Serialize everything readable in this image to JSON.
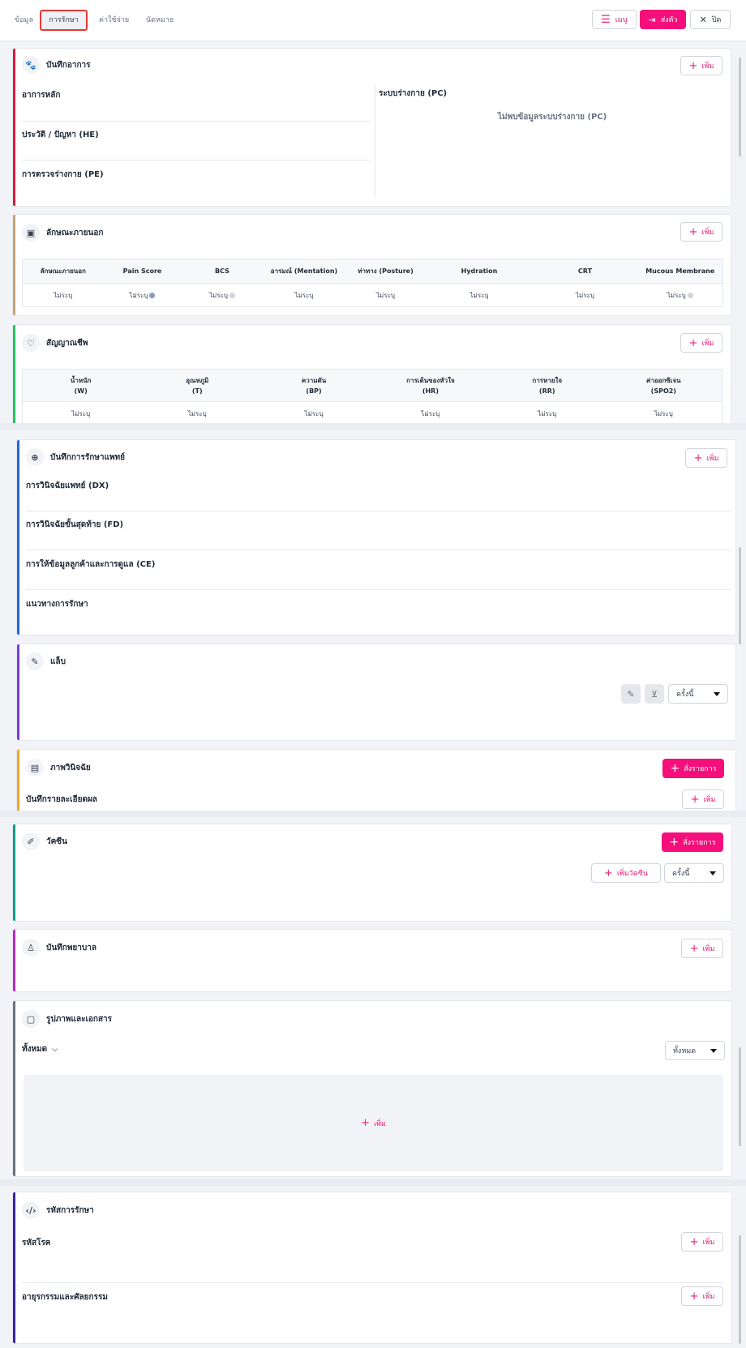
{
  "tabs": [
    "ข้อมูล",
    "การรักษา",
    "ค่าใช้จ่าย",
    "นัดหมาย"
  ],
  "actions": {
    "menu": "เมนู",
    "transfer": "ส่งตัว",
    "close": "ปิด"
  },
  "common": {
    "add": "เพิ่ม",
    "not_specified": "ไม่ระบุ",
    "order": "สั่งรายการ",
    "this_time": "ครั้งนี้",
    "all": "ทั้งหมด"
  },
  "symptoms": {
    "title": "บันทึกอาการ",
    "chief": "อาการหลัก",
    "history": "ประวัติ / ปัญหา (HE)",
    "exam": "การตรวจร่างกาย (PE)",
    "system": "ระบบร่างกาย (PC)",
    "system_empty": "ไม่พบข้อมูลระบบร่างกาย (PC)"
  },
  "appearance": {
    "title": "ลักษณะภายนอก",
    "headers": [
      "ลักษณะภายนอก",
      "Pain Score",
      "BCS",
      "อารมณ์ (Mentation)",
      "ท่าทาง (Posture)",
      "Hydration",
      "CRT",
      "Mucous Membrane"
    ]
  },
  "vitals": {
    "title": "สัญญาณชีพ",
    "headers": [
      {
        "top": "น้ำหนัก",
        "sub": "(W)"
      },
      {
        "top": "อุณหภูมิ",
        "sub": "(T)"
      },
      {
        "top": "ความดัน",
        "sub": "(BP)"
      },
      {
        "top": "การเต้นของหัวใจ",
        "sub": "(HR)"
      },
      {
        "top": "การหายใจ",
        "sub": "(RR)"
      },
      {
        "top": "ค่าออกซิเจน",
        "sub": "(SPO2)"
      }
    ]
  },
  "treatment": {
    "title": "บันทึกการรักษาแพทย์",
    "dx": "การวินิจฉัยแพทย์ (DX)",
    "fd": "การวินิจฉัยขั้นสุดท้าย (FD)",
    "ce": "การให้ข้อมูลลูกค้าและการดูแล (CE)",
    "plan": "แนวทางการรักษา"
  },
  "lab": {
    "title": "แล็บ"
  },
  "imaging": {
    "title": "ภาพวินิจฉัย",
    "record": "บันทึกรายละเอียดผล"
  },
  "vaccine": {
    "title": "วัคซีน",
    "add_vaccine": "เพิ่มวัคซีน"
  },
  "nursing": {
    "title": "บันทึกพยาบาล"
  },
  "documents": {
    "title": "รูปภาพและเอกสาร",
    "filter": "ทั้งหมด"
  },
  "codes": {
    "title": "รหัสการรักษา",
    "disease": "รหัสโรค",
    "procedure": "อายุรกรรมและศัลยกรรม"
  },
  "colors": {
    "accent": "#f50f7a",
    "symptoms": "#d81b3c",
    "appearance": "#c8a27a",
    "vitals": "#22c55e",
    "treatment": "#2563eb",
    "lab": "#7c3aed",
    "imaging": "#f5a623",
    "vaccine": "#0f9d8a",
    "nursing": "#b829c9",
    "documents": "#6b7280",
    "codes": "#3b1fb0"
  }
}
